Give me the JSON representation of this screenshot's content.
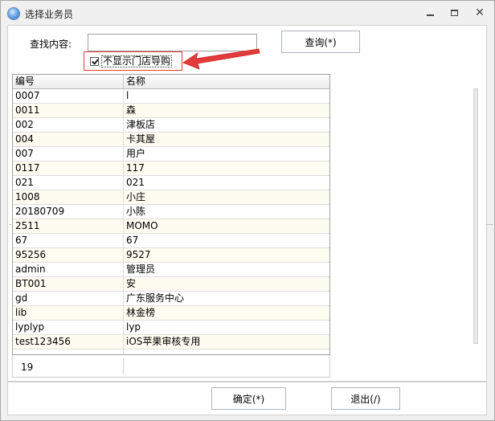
{
  "window": {
    "title": "选择业务员",
    "close_glyph": "✕"
  },
  "search": {
    "label": "查找内容:",
    "value": "",
    "button": "查询(*)"
  },
  "filter": {
    "label": "不显示门店导购",
    "checked": true
  },
  "grid": {
    "columns": [
      "编号",
      "名称"
    ],
    "rows": [
      [
        "0007",
        "l"
      ],
      [
        "0011",
        "森"
      ],
      [
        "002",
        "津板店"
      ],
      [
        "004",
        "卡其屋"
      ],
      [
        "007",
        "用户"
      ],
      [
        "0117",
        "117"
      ],
      [
        "021",
        "021"
      ],
      [
        "1008",
        "小庄"
      ],
      [
        "20180709",
        "小陈"
      ],
      [
        "2511",
        "MOMO"
      ],
      [
        "67",
        "67"
      ],
      [
        "95256",
        "9527"
      ],
      [
        "admin",
        "管理员"
      ],
      [
        "BT001",
        "安"
      ],
      [
        "gd",
        "广东服务中心"
      ],
      [
        "lib",
        "林金榜"
      ],
      [
        "lyplyp",
        "lyp"
      ],
      [
        "test123456",
        "iOS苹果审核专用"
      ],
      [
        "",
        ""
      ]
    ],
    "count": "19"
  },
  "actions": {
    "ok": "确定(*)",
    "exit": "退出(/)"
  },
  "icons": {
    "app": "globe-icon",
    "minimize": "minimize-icon",
    "maximize": "maximize-icon",
    "close": "close-icon",
    "annotation": "red-arrow-icon"
  },
  "colors": {
    "annotation": "#e23b3b",
    "row_alt": "#fdfcf0"
  }
}
